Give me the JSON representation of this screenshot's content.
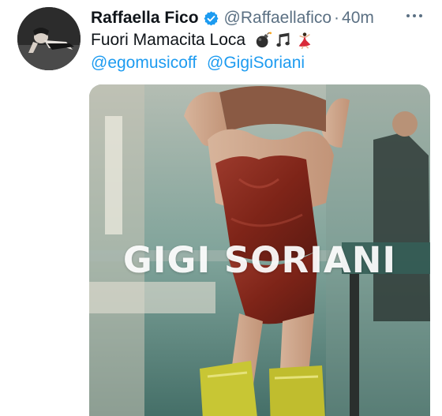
{
  "tweet": {
    "display_name": "Raffaella Fico",
    "handle": "@Raffaellafico",
    "separator": "·",
    "time": "40m",
    "text": "Fuori Mamacita Loca",
    "emojis": [
      "bomb-emoji",
      "music-notes-emoji",
      "dancer-emoji"
    ],
    "mentions": [
      "@egomusicoff",
      "@GigiSoriani"
    ],
    "media": {
      "overlay_text": "GIGI SORIANI"
    }
  },
  "colors": {
    "text": "#0f1419",
    "secondary": "#5b7083",
    "link": "#1d9bf0",
    "verified": "#1d9bf0"
  }
}
